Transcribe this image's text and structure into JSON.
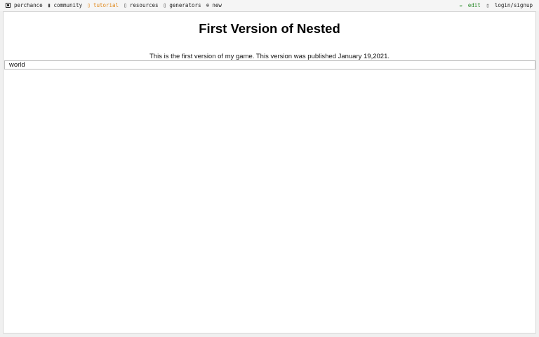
{
  "topbar": {
    "brand": {
      "label": "perchance",
      "icon": "dice-icon"
    },
    "items": [
      {
        "label": "community",
        "icon": "chat-icon"
      },
      {
        "label": "tutorial",
        "icon": "book-icon",
        "active": true
      },
      {
        "label": "resources",
        "icon": "folder-icon"
      },
      {
        "label": "generators",
        "icon": "gear-icon"
      },
      {
        "label": "new",
        "icon": "plus-circle-icon"
      }
    ],
    "edit_label": "edit",
    "login_label": "login/signup"
  },
  "page": {
    "title": "First Version of Nested",
    "description": "This is the first version of my game. This version was published January 19,2021.",
    "output": "world"
  },
  "colors": {
    "accent_active": "#e08a1e",
    "edit_green": "#2a8a2a"
  }
}
